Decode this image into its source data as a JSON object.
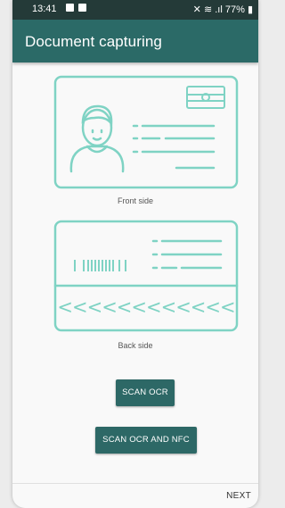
{
  "status_bar": {
    "time": "13:41",
    "battery": "77%"
  },
  "app_bar": {
    "title": "Document capturing"
  },
  "front_card": {
    "caption": "Front side"
  },
  "back_card": {
    "caption": "Back side",
    "mrz_text": "<<<<<<<<<<<<"
  },
  "buttons": {
    "scan_ocr": "SCAN OCR",
    "scan_ocr_nfc": "SCAN OCR AND NFC",
    "next": "NEXT"
  },
  "colors": {
    "accent": "#2b6a67",
    "card_line": "#7fd3c4",
    "status_bar": "#243a38"
  }
}
